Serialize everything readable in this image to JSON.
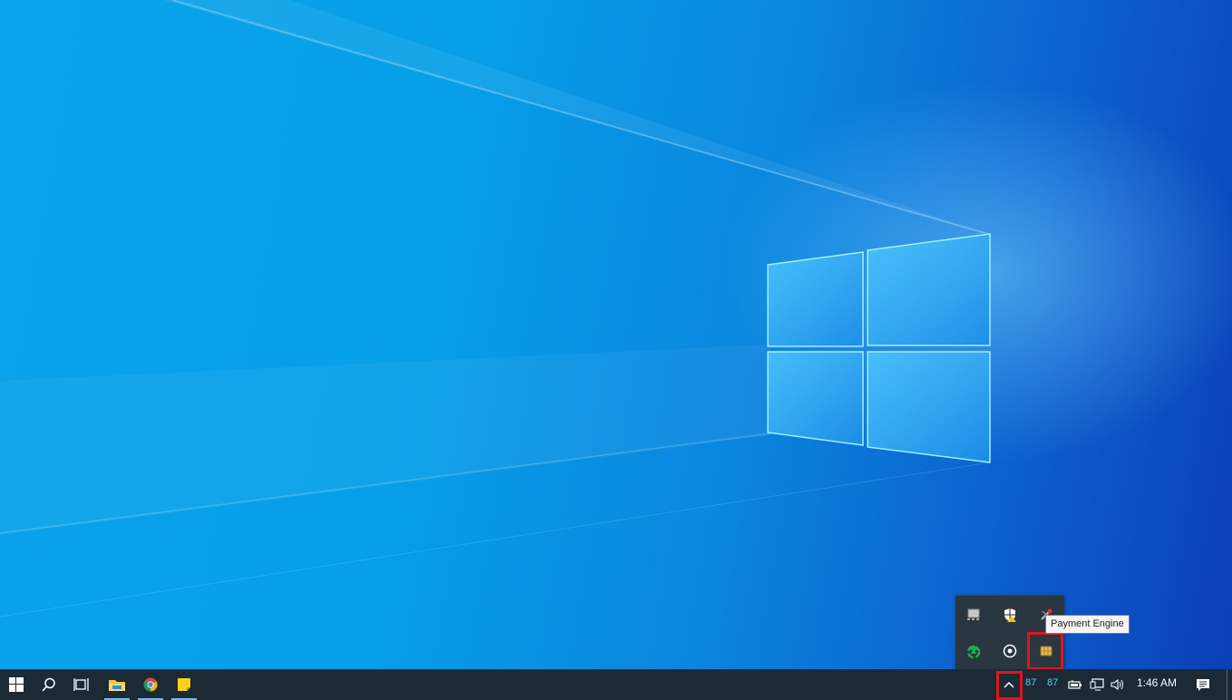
{
  "desktop": {
    "wallpaper": "windows-10-hero",
    "accent": "#0a86de"
  },
  "taskbar": {
    "background": "#1b2a35",
    "start_icon": "windows-start-icon",
    "search_icon": "search-icon",
    "task_view_icon": "task-view-icon",
    "pinned_apps": [
      {
        "name": "File Explorer",
        "icon": "folder-icon"
      },
      {
        "name": "Google Chrome",
        "icon": "chrome-icon"
      },
      {
        "name": "Sticky Notes",
        "icon": "sticky-notes-icon"
      }
    ],
    "tray": {
      "chevron_icon": "chevron-up-icon",
      "temp_readouts": [
        "87",
        "87"
      ],
      "battery_icon": "battery-icon",
      "network_icon": "network-icon",
      "volume_icon": "volume-icon",
      "clock": "1:46 AM",
      "notification_icon": "action-center-icon"
    }
  },
  "tray_overflow": {
    "icons": [
      "display-icon",
      "security-shield-icon",
      "tools-icon",
      "recycle-icon",
      "record-icon",
      "payment-engine-icon"
    ],
    "tooltip": "Payment Engine"
  },
  "highlights": {
    "color": "#e2131f"
  }
}
